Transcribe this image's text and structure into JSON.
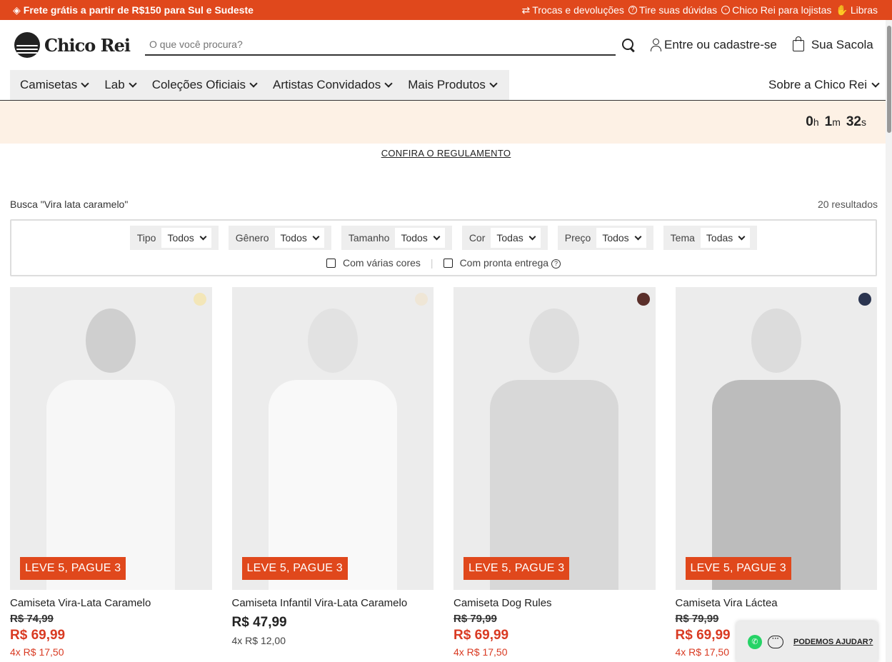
{
  "topbar": {
    "promo": "Frete grátis a partir de R$150 para Sul e Sudeste",
    "links": [
      "Trocas e devoluções",
      "Tire suas dúvidas",
      "Chico Rei para lojistas",
      "Libras"
    ]
  },
  "header": {
    "brand": "Chico Rei",
    "search_placeholder": "O que você procura?",
    "account_label": "Entre ou cadastre-se",
    "bag_label": "Sua Sacola"
  },
  "nav": {
    "items": [
      "Camisetas",
      "Lab",
      "Coleções Oficiais",
      "Artistas Convidados",
      "Mais Produtos"
    ],
    "right": "Sobre a Chico Rei"
  },
  "countdown": {
    "h": "0",
    "m": "1",
    "s": "32",
    "h_unit": "h",
    "m_unit": "m",
    "s_unit": "s"
  },
  "regulamento": "CONFIRA O REGULAMENTO",
  "search": {
    "query_label": "Busca \"Vira lata caramelo\"",
    "results": "20 resultados"
  },
  "filters": [
    {
      "label": "Tipo",
      "value": "Todos"
    },
    {
      "label": "Gênero",
      "value": "Todos"
    },
    {
      "label": "Tamanho",
      "value": "Todos"
    },
    {
      "label": "Cor",
      "value": "Todas"
    },
    {
      "label": "Preço",
      "value": "Todos"
    },
    {
      "label": "Tema",
      "value": "Todas"
    }
  ],
  "checks": {
    "multi_color": "Com várias cores",
    "ready": "Com pronta entrega"
  },
  "products": [
    {
      "name": "Camiseta Vira-Lata Caramelo",
      "old_price": "R$ 74,99",
      "price": "R$ 69,99",
      "installments": "4x R$ 17,50",
      "badge": "LEVE 5, PAGUE 3",
      "swatch": "#f3e6b8",
      "shirt": "#f7f7f7",
      "skin": "#cfcfcf"
    },
    {
      "name": "Camiseta Infantil Vira-Lata Caramelo",
      "old_price": "",
      "price": "R$ 47,99",
      "installments": "4x R$ 12,00",
      "badge": "LEVE 5, PAGUE 3",
      "swatch": "#efe6d6",
      "shirt": "#f9f9f9",
      "skin": "#e2e2e2"
    },
    {
      "name": "Camiseta Dog Rules",
      "old_price": "R$ 79,99",
      "price": "R$ 69,99",
      "installments": "4x R$ 17,50",
      "badge": "LEVE 5, PAGUE 3",
      "swatch": "#5a2f2a",
      "shirt": "#d8d8d8",
      "skin": "#dedede"
    },
    {
      "name": "Camiseta Vira Láctea",
      "old_price": "R$ 79,99",
      "price": "R$ 69,99",
      "installments": "4x R$ 17,50",
      "badge": "LEVE 5, PAGUE 3",
      "swatch": "#2b3550",
      "shirt": "#bcbcbc",
      "skin": "#dcdcdc"
    }
  ],
  "help_widget": {
    "label": "PODEMOS AJUDAR?"
  }
}
